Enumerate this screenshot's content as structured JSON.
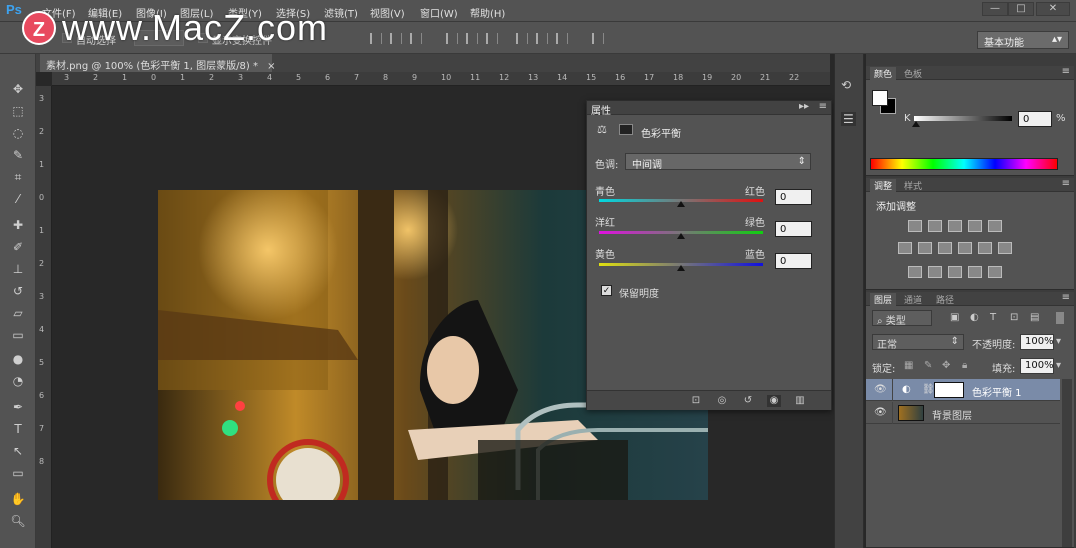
{
  "app": {
    "logo": "Ps",
    "window_controls": [
      "—",
      "□",
      "✕"
    ]
  },
  "watermark": {
    "badge": "Z",
    "text": "www.MacZ.com"
  },
  "menu": [
    "文件(F)",
    "编辑(E)",
    "图像(I)",
    "图层(L)",
    "类型(Y)",
    "选择(S)",
    "滤镜(T)",
    "视图(V)",
    "窗口(W)",
    "帮助(H)"
  ],
  "options_bar": {
    "auto_select": "自动选择",
    "show_transform": "显示变换控件",
    "workspace": "基本功能"
  },
  "document": {
    "tab_title": "素材.png @ 100% (色彩平衡 1, 图层蒙版/8) *"
  },
  "rulers": {
    "h_ticks": [
      "3",
      "2",
      "1",
      "0",
      "1",
      "2",
      "3",
      "4",
      "5",
      "6",
      "7",
      "8",
      "9",
      "10",
      "11",
      "12",
      "13",
      "14",
      "15",
      "16",
      "17",
      "18",
      "19",
      "20",
      "21",
      "22"
    ],
    "v_ticks": [
      "3",
      "2",
      "1",
      "0",
      "1",
      "2",
      "3",
      "4",
      "5",
      "6",
      "7",
      "8"
    ]
  },
  "properties": {
    "tab": "属性",
    "title": "色彩平衡",
    "tone_label": "色调:",
    "tone_value": "中间调",
    "sliders": [
      {
        "left": "青色",
        "right": "红色",
        "value": "0",
        "colors": [
          "#00d8e0",
          "#e01010"
        ]
      },
      {
        "left": "洋红",
        "right": "绿色",
        "value": "0",
        "colors": [
          "#e010e0",
          "#10d010"
        ]
      },
      {
        "left": "黄色",
        "right": "蓝色",
        "value": "0",
        "colors": [
          "#e0e010",
          "#1010e0"
        ]
      }
    ],
    "preserve_luminosity": "保留明度"
  },
  "color_panel": {
    "tabs": [
      "颜色",
      "色板"
    ],
    "channel": "K",
    "value": "0",
    "unit": "%"
  },
  "adjustments_panel": {
    "tabs": [
      "调整",
      "样式"
    ],
    "title": "添加调整"
  },
  "layers_panel": {
    "tabs": [
      "图层",
      "通道",
      "路径"
    ],
    "filter": "类型",
    "blend_mode": "正常",
    "opacity_label": "不透明度:",
    "opacity": "100%",
    "lock_label": "锁定:",
    "fill_label": "填充:",
    "fill": "100%",
    "layers": [
      {
        "name": "色彩平衡 1",
        "selected": true
      },
      {
        "name": "背景图层",
        "selected": false
      }
    ]
  }
}
